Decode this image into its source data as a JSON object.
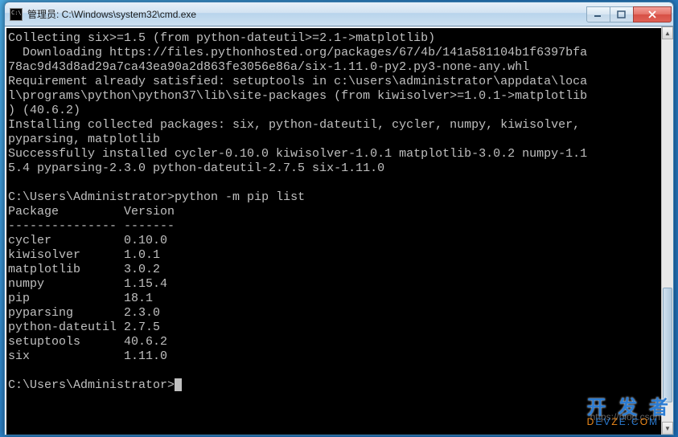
{
  "window": {
    "title": "管理员: C:\\Windows\\system32\\cmd.exe"
  },
  "terminal": {
    "lines": {
      "l1": "Collecting six>=1.5 (from python-dateutil>=2.1->matplotlib)",
      "l2": "  Downloading https://files.pythonhosted.org/packages/67/4b/141a581104b1f6397bfa",
      "l3": "78ac9d43d8ad29a7ca43ea90a2d863fe3056e86a/six-1.11.0-py2.py3-none-any.whl",
      "l4": "Requirement already satisfied: setuptools in c:\\users\\administrator\\appdata\\loca",
      "l5": "l\\programs\\python\\python37\\lib\\site-packages (from kiwisolver>=1.0.1->matplotlib",
      "l6": ") (40.6.2)",
      "l7": "Installing collected packages: six, python-dateutil, cycler, numpy, kiwisolver,",
      "l8": "pyparsing, matplotlib",
      "l9": "Successfully installed cycler-0.10.0 kiwisolver-1.0.1 matplotlib-3.0.2 numpy-1.1",
      "l10": "5.4 pyparsing-2.3.0 python-dateutil-2.7.5 six-1.11.0",
      "blank1": "",
      "prompt1_path": "C:\\Users\\Administrator>",
      "prompt1_cmd": "python -m pip list",
      "header": "Package         Version",
      "divider": "--------------- -------",
      "pkg1": "cycler          0.10.0",
      "pkg2": "kiwisolver      1.0.1",
      "pkg3": "matplotlib      3.0.2",
      "pkg4": "numpy           1.15.4",
      "pkg5": "pip             18.1",
      "pkg6": "pyparsing       2.3.0",
      "pkg7": "python-dateutil 2.7.5",
      "pkg8": "setuptools      40.6.2",
      "pkg9": "six             1.11.0",
      "blank2": "",
      "prompt2_path": "C:\\Users\\Administrator>"
    }
  },
  "packages": [
    {
      "name": "cycler",
      "version": "0.10.0"
    },
    {
      "name": "kiwisolver",
      "version": "1.0.1"
    },
    {
      "name": "matplotlib",
      "version": "3.0.2"
    },
    {
      "name": "numpy",
      "version": "1.15.4"
    },
    {
      "name": "pip",
      "version": "18.1"
    },
    {
      "name": "pyparsing",
      "version": "2.3.0"
    },
    {
      "name": "python-dateutil",
      "version": "2.7.5"
    },
    {
      "name": "setuptools",
      "version": "40.6.2"
    },
    {
      "name": "six",
      "version": "1.11.0"
    }
  ],
  "watermark": {
    "url": "https://blog.csdn",
    "brand_cn": "开 发 者",
    "brand_en1": "D",
    "brand_en2": "EV",
    "brand_en3": "Z",
    "brand_en4": "E.C",
    "brand_en5": "O",
    "brand_en6": "M"
  }
}
